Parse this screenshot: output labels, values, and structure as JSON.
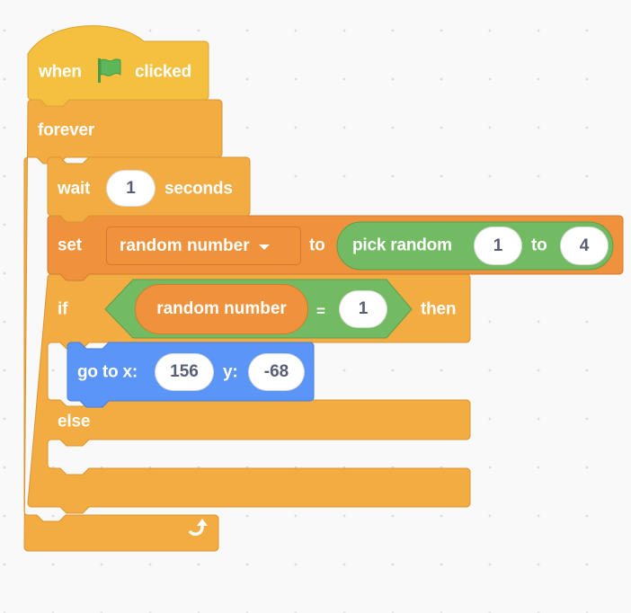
{
  "workspace": {
    "type": "scratch-script-area"
  },
  "colors": {
    "events": "#f5c040",
    "control": "#f2ac42",
    "variables": "#f0913b",
    "operators": "#72bb62",
    "motion": "#5b95f7",
    "input_text": "#575e75",
    "flag": "#5cb65a"
  },
  "script": {
    "hat": {
      "when_label": "when",
      "icon": "green-flag-icon",
      "clicked_label": "clicked"
    },
    "forever": {
      "label": "forever",
      "loop_icon": "loop-arrow-icon"
    },
    "wait": {
      "label": "wait",
      "value": "1",
      "unit_label": "seconds"
    },
    "set_variable": {
      "label": "set",
      "variable": "random number",
      "to_label": "to",
      "pick_random": {
        "label": "pick random",
        "from": "1",
        "to_label": "to",
        "to": "4"
      }
    },
    "if_else": {
      "if_label": "if",
      "then_label": "then",
      "else_label": "else",
      "condition": {
        "variable": "random number",
        "operator": "=",
        "value": "1"
      },
      "if_branch": {
        "goto": {
          "label": "go to x:",
          "x": "156",
          "y_label": "y:",
          "y": "-68"
        }
      },
      "else_branch": []
    }
  }
}
